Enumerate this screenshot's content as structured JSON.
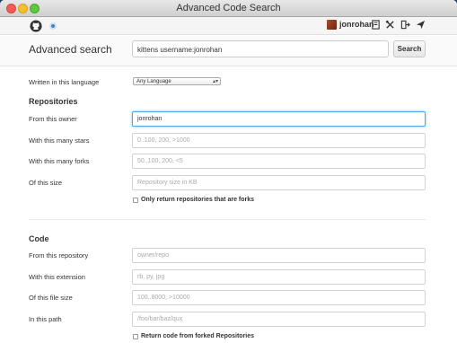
{
  "window": {
    "title": "Advanced Code Search"
  },
  "header": {
    "username": "jonrohan",
    "icons": [
      "github-octocat-icon",
      "status-dot",
      "avatar",
      "new-repo-icon",
      "settings-icon",
      "sign-out-icon",
      "notifications-icon"
    ]
  },
  "search": {
    "title": "Advanced search",
    "query": "kittens username:jonrohan",
    "button": "Search"
  },
  "language": {
    "label": "Written in this language",
    "selected": "Any Language"
  },
  "repositories": {
    "title": "Repositories",
    "owner_label": "From this owner",
    "owner_value": "jonrohan",
    "stars_label": "With this many stars",
    "stars_placeholder": "0..100, 200, >1000",
    "forks_label": "With this many forks",
    "forks_placeholder": "50..100, 200, <5",
    "size_label": "Of this size",
    "size_placeholder": "Repository size in KB",
    "forks_only_label": "Only return repositories that are forks"
  },
  "code": {
    "title": "Code",
    "repo_label": "From this repository",
    "repo_placeholder": "owner/repo",
    "ext_label": "With this extension",
    "ext_placeholder": "rb, py, jpg",
    "filesize_label": "Of this file size",
    "filesize_placeholder": "100..8000, >10000",
    "path_label": "In this path",
    "path_placeholder": "/foo/bar/baz/qux",
    "forked_label": "Return code from forked Repositories"
  },
  "colors": {
    "focus": "#51a7e8",
    "accent": "#4183c4"
  }
}
